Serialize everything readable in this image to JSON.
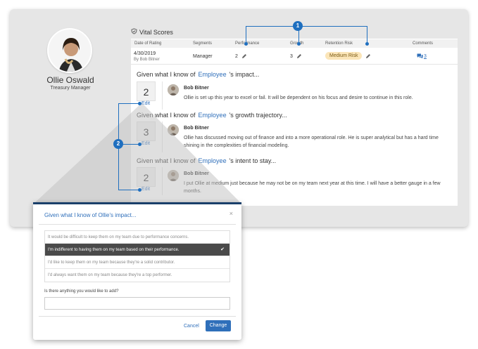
{
  "profile": {
    "name": "Ollie Oswald",
    "role": "Treasury Manager"
  },
  "vital": {
    "title": "Vital Scores",
    "columns": [
      "Date of Rating",
      "Segments",
      "Performance",
      "Growth",
      "Retention Risk",
      "Comments"
    ],
    "row": {
      "date": "4/30/2019",
      "by": "By Bob Bitner",
      "segment": "Manager",
      "performance": "2",
      "growth": "3",
      "retention": "Medium Risk",
      "comments": "3"
    }
  },
  "questions": [
    {
      "prefix": "Given what I know of",
      "employee": "Employee",
      "suffix": "'s impact...",
      "score": "2",
      "edit": "Edit",
      "author": "Bob Bitner",
      "comment": "Ollie is set up this year to excel or fail. It will be dependent on his focus and desire to continue in this role."
    },
    {
      "prefix": "Given what I know of",
      "employee": "Employee",
      "suffix": "'s growth trajectory...",
      "score": "3",
      "edit": "Edit",
      "author": "Bob Bitner",
      "comment": "Ollie has discussed moving out of finance and into a more operational role. He is super analytical but has a hard time shining in the complexities of financial modeling."
    },
    {
      "prefix": "Given what I know of",
      "employee": "Employee",
      "suffix": "'s intent to stay...",
      "score": "2",
      "edit": "Edit",
      "author": "Bob Bitner",
      "comment": "I put Ollie at medium just because he may not be on my team next year at this time. I will have a better gauge in a few months."
    }
  ],
  "callouts": [
    "1",
    "2"
  ],
  "modal": {
    "title": "Given what I know of Ollie's impact...",
    "close": "×",
    "options": [
      "It would be difficult to keep them on my team due to performance concerns.",
      "I'm indifferent to having them on my team based on their performance.",
      "I'd like to keep them on my team because they're a solid contributor.",
      "I'd always want them on my team because they're a top performer."
    ],
    "selected_check": "✔",
    "add_label": "Is there anything you would like to add?",
    "cancel": "Cancel",
    "change": "Change"
  },
  "colors": {
    "accent": "#2f6fba",
    "callout": "#1f6fbf",
    "badge": "#fbe5b8"
  }
}
